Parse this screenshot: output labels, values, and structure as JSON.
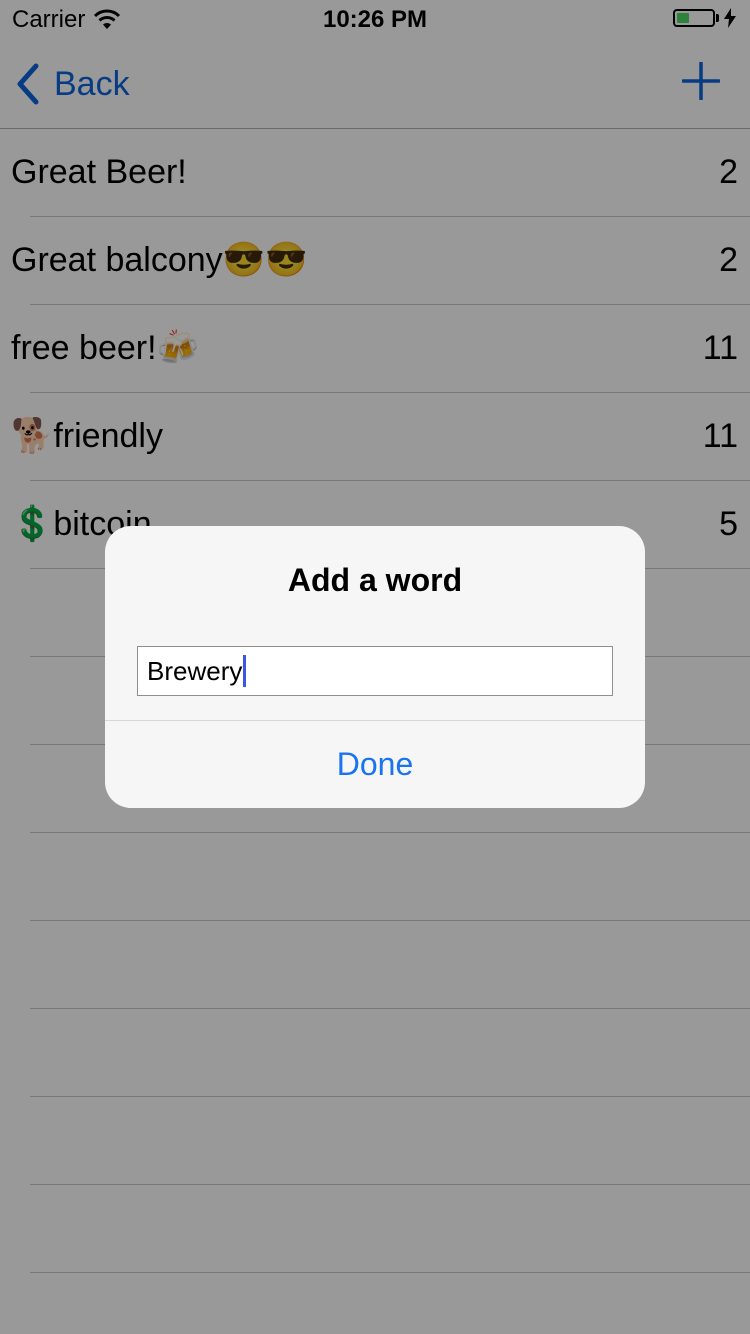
{
  "status_bar": {
    "carrier": "Carrier",
    "time": "10:26 PM",
    "battery_level": 0.35
  },
  "nav": {
    "back_label": "Back",
    "add_icon": "plus-icon"
  },
  "rows": [
    {
      "label": "Great Beer!",
      "count": "2"
    },
    {
      "label": "Great balcony😎😎",
      "count": "2"
    },
    {
      "label": "free beer!🍻",
      "count": "11"
    },
    {
      "label": "🐕friendly",
      "count": "11"
    },
    {
      "label": "💲bitcoin",
      "count": "5"
    }
  ],
  "alert": {
    "title": "Add a word",
    "input_value": "Brewery",
    "done_label": "Done"
  },
  "colors": {
    "accent": "#0c63dc",
    "alert_button": "#1a73f0",
    "caret": "#3b55e6",
    "battery_fill": "#4cd964"
  }
}
